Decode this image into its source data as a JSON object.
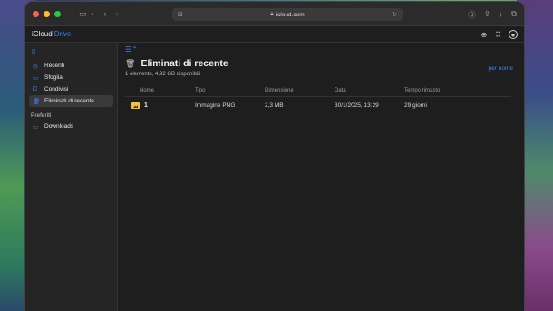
{
  "browser": {
    "url": "icloud.com"
  },
  "header": {
    "brand_prefix": "iCloud",
    "brand_suffix": "Drive"
  },
  "sidebar": {
    "items": [
      {
        "label": "Recenti",
        "icon": "clock-icon"
      },
      {
        "label": "Sfoglia",
        "icon": "folder-icon"
      },
      {
        "label": "Condivisi",
        "icon": "shared-folder-icon"
      },
      {
        "label": "Eliminati di recente",
        "icon": "trash-icon",
        "active": true
      }
    ],
    "section_label": "Preferiti",
    "favorites": [
      {
        "label": "Downloads",
        "icon": "folder-icon"
      }
    ]
  },
  "main": {
    "title": "Eliminati di recente",
    "subtitle": "1 elemento, 4,92 GB disponibili",
    "sort_label": "per nome",
    "columns": [
      "Nome",
      "Tipo",
      "Dimensione",
      "Data",
      "Tempo rimasto"
    ],
    "rows": [
      {
        "name": "1",
        "type": "Immagine PNG",
        "size": "2,3 MB",
        "date": "30/1/2025, 13:29",
        "remaining": "29 giorni"
      }
    ]
  },
  "colors": {
    "accent": "#3b82f6",
    "window_bg": "#1e1e1e",
    "sidebar_bg": "#252525"
  }
}
